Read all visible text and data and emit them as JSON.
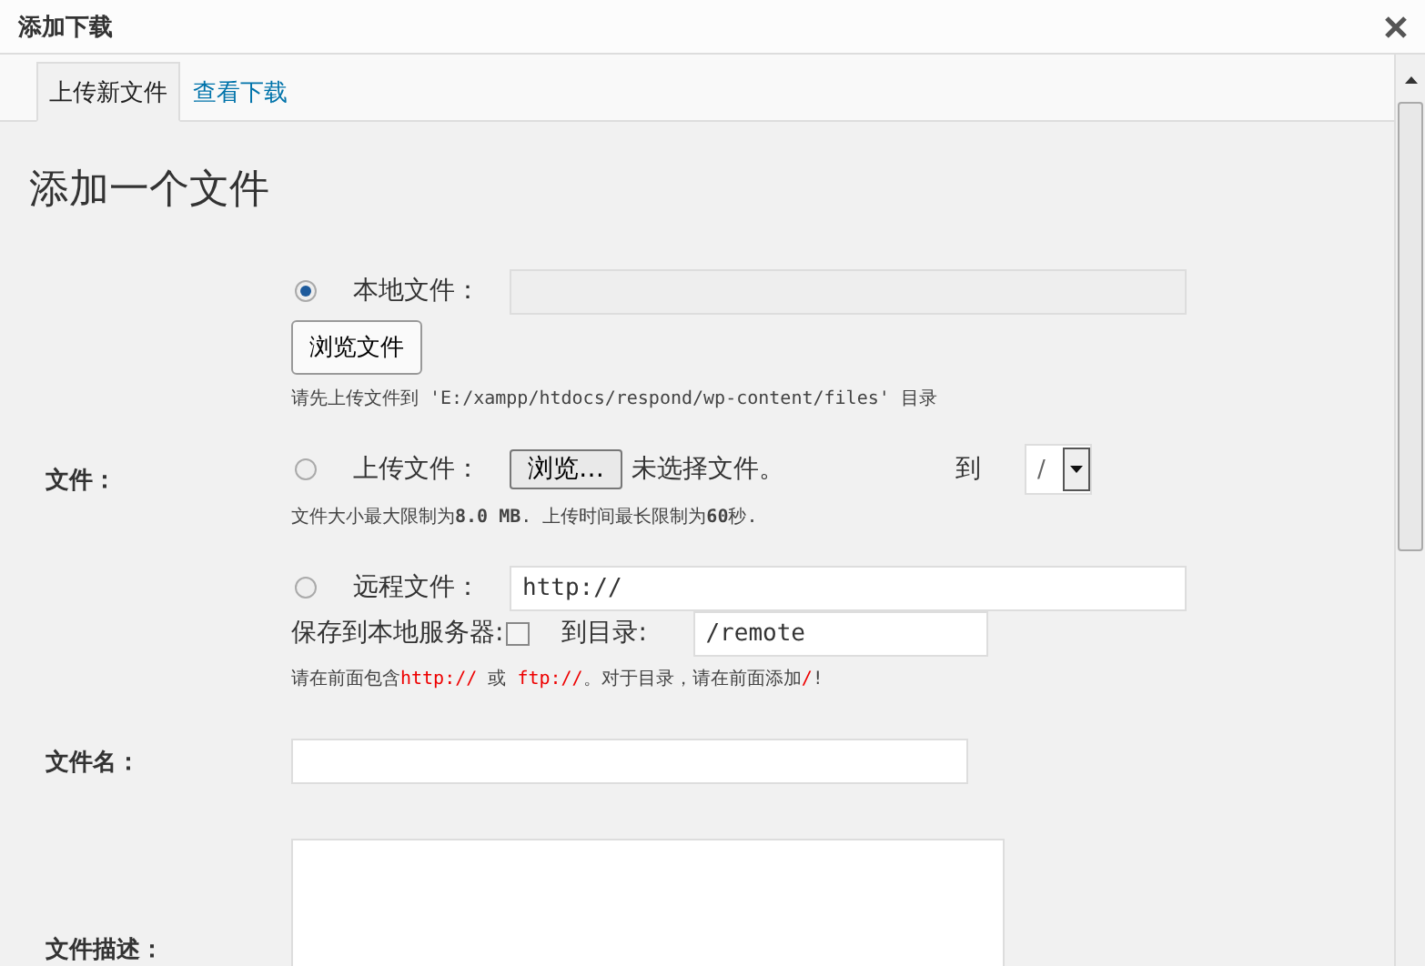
{
  "dialog": {
    "title": "添加下载"
  },
  "tabs": [
    {
      "label": "上传新文件",
      "selected": true
    },
    {
      "label": "查看下载",
      "selected": false
    }
  ],
  "heading": "添加一个文件",
  "file": {
    "label": "文件：",
    "local": {
      "label": "本地文件：",
      "selected": true,
      "button": "浏览文件",
      "hint": "请先上传文件到 'E:/xampp/htdocs/respond/wp-content/files' 目录"
    },
    "upload": {
      "label": "上传文件：",
      "selected": false,
      "button": "浏览…",
      "status": "未选择文件。",
      "to_label": "到",
      "folder": "/",
      "hint": "文件大小最大限制为**8.0 MB**. 上传时间最长限制为**60**秒."
    },
    "remote": {
      "label": "远程文件：",
      "selected": false,
      "url": "http://",
      "save_label": "保存到本地服务器:",
      "save_checked": false,
      "dir_label": "到目录:",
      "dir": "/remote",
      "hint": [
        {
          "text": "请在前面包含",
          "highlight": false
        },
        {
          "text": "http://",
          "highlight": true
        },
        {
          "text": " 或 ",
          "highlight": false
        },
        {
          "text": "ftp://",
          "highlight": true
        },
        {
          "text": "。对于目录，请在前面添加",
          "highlight": false
        },
        {
          "text": "/",
          "highlight": true
        },
        {
          "text": "!",
          "highlight": false
        }
      ]
    }
  },
  "name_label": "文件名：",
  "desc_label": "文件描述："
}
